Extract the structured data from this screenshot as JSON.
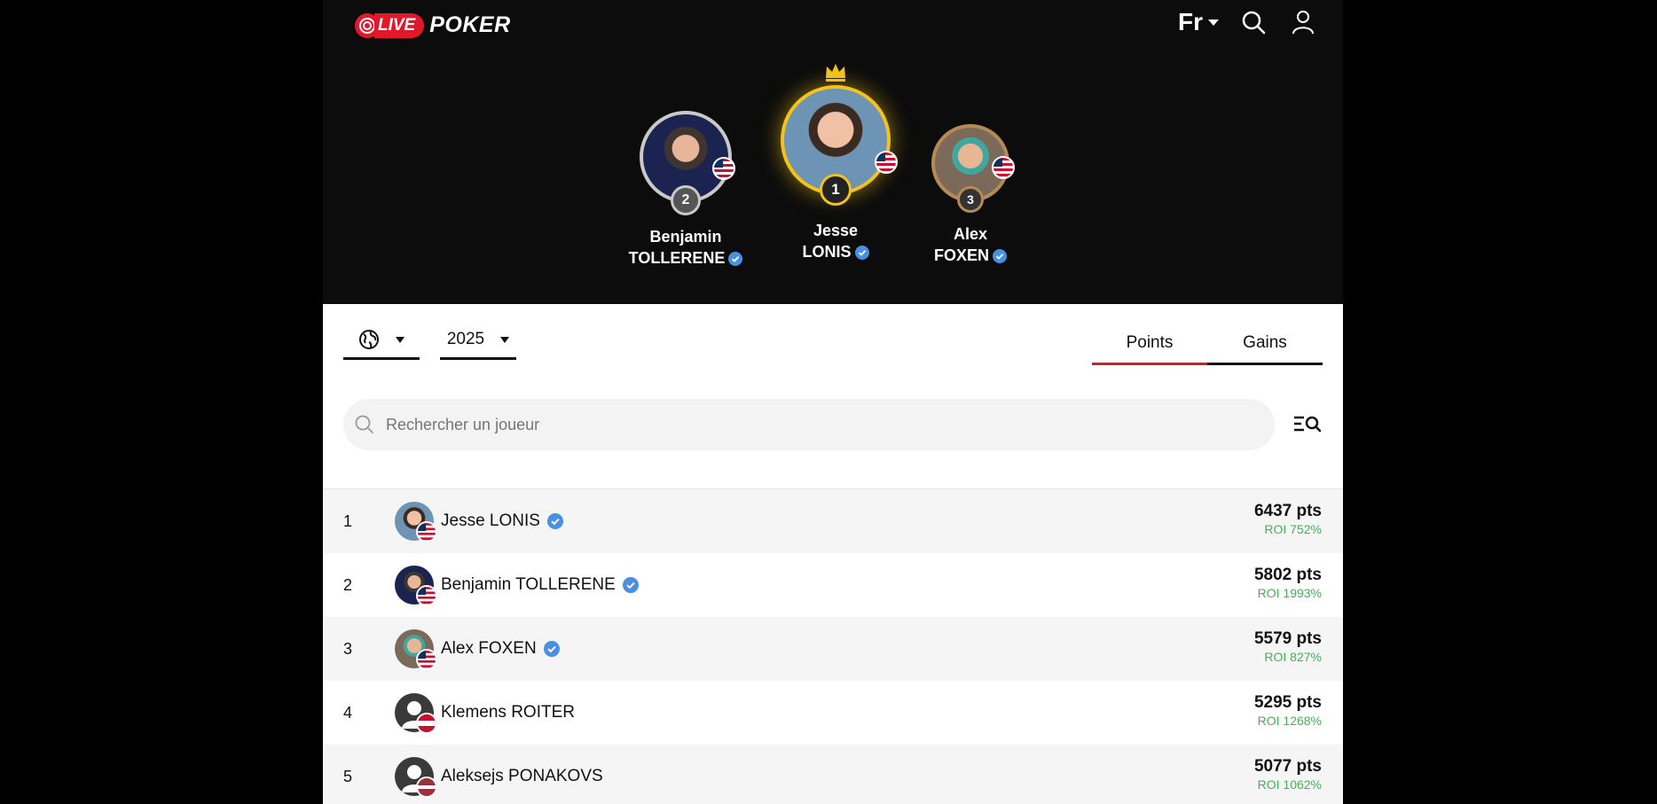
{
  "header": {
    "logo_live": "LIVE",
    "logo_poker": "POKER",
    "language": "Fr"
  },
  "podium": [
    {
      "rank": "2",
      "first": "Benjamin",
      "last": "TOLLERENE"
    },
    {
      "rank": "1",
      "first": "Jesse",
      "last": "LONIS"
    },
    {
      "rank": "3",
      "first": "Alex",
      "last": "FOXEN"
    }
  ],
  "filters": {
    "region_icon": "globe-icon",
    "year": "2025",
    "tabs": [
      {
        "label": "Points",
        "active": true
      },
      {
        "label": "Gains",
        "active": false
      }
    ]
  },
  "search": {
    "placeholder": "Rechercher un joueur"
  },
  "ranking": [
    {
      "rank": "1",
      "name": "Jesse LONIS",
      "verified": true,
      "flag": "us",
      "pts": "6437 pts",
      "roi": "ROI 752%"
    },
    {
      "rank": "2",
      "name": "Benjamin TOLLERENE",
      "verified": true,
      "flag": "us",
      "pts": "5802 pts",
      "roi": "ROI 1993%"
    },
    {
      "rank": "3",
      "name": "Alex FOXEN",
      "verified": true,
      "flag": "us",
      "pts": "5579 pts",
      "roi": "ROI 827%"
    },
    {
      "rank": "4",
      "name": "Klemens ROITER",
      "verified": false,
      "flag": "at",
      "pts": "5295 pts",
      "roi": "ROI 1268%"
    },
    {
      "rank": "5",
      "name": "Aleksejs PONAKOVS",
      "verified": false,
      "flag": "lv",
      "pts": "5077 pts",
      "roi": "ROI 1062%"
    }
  ],
  "colors": {
    "brand_red": "#e2172a",
    "gold": "#f3c21b",
    "silver": "#c9c9c9",
    "bronze": "#b68a55",
    "verified_blue": "#4a90e2",
    "roi_green": "#3fb44f"
  }
}
